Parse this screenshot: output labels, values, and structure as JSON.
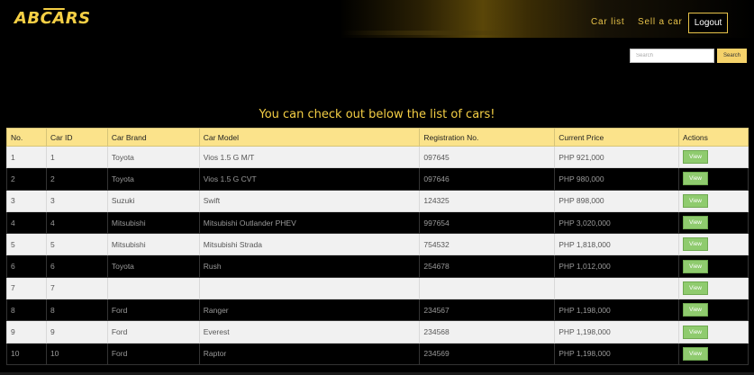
{
  "nav": {
    "logo": "ABCARS",
    "links": [
      "Car list",
      "Sell a car"
    ],
    "logout_label": "Logout"
  },
  "search": {
    "placeholder": "Search",
    "button_label": "Search"
  },
  "heading": "You can check out below the list of cars!",
  "table": {
    "headers": [
      "No.",
      "Car ID",
      "Car Brand",
      "Car Model",
      "Registration No.",
      "Current Price",
      "Actions"
    ],
    "rows": [
      [
        "1",
        "1",
        "Toyota",
        "Vios 1.5 G M/T",
        "097645",
        "PHP 921,000"
      ],
      [
        "2",
        "2",
        "Toyota",
        "Vios 1.5 G CVT",
        "097646",
        "PHP 980,000"
      ],
      [
        "3",
        "3",
        "Suzuki",
        "Swift",
        "124325",
        "PHP 898,000"
      ],
      [
        "4",
        "4",
        "Mitsubishi",
        "Mitsubishi Outlander PHEV",
        "997654",
        "PHP 3,020,000"
      ],
      [
        "5",
        "5",
        "Mitsubishi",
        "Mitsubishi Strada",
        "754532",
        "PHP 1,818,000"
      ],
      [
        "6",
        "6",
        "Toyota",
        "Rush",
        "254678",
        "PHP 1,012,000"
      ],
      [
        "7",
        "7",
        "",
        "",
        "",
        ""
      ],
      [
        "8",
        "8",
        "Ford",
        "Ranger",
        "234567",
        "PHP 1,198,000"
      ],
      [
        "9",
        "9",
        "Ford",
        "Everest",
        "234568",
        "PHP 1,198,000"
      ],
      [
        "10",
        "10",
        "Ford",
        "Raptor",
        "234569",
        "PHP 1,198,000"
      ]
    ],
    "action_label": "View"
  },
  "colors": {
    "accent": "#f5cf45",
    "header_bg": "#fbe38b",
    "view_button": "#8fcb6e"
  }
}
